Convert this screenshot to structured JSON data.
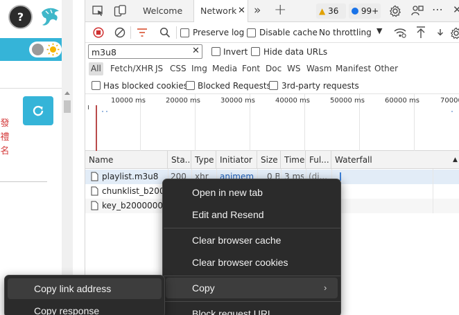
{
  "devtools": {
    "tabs": [
      {
        "label": "Welcome"
      },
      {
        "label": "Network"
      }
    ],
    "badges": {
      "warnings": "36",
      "issues": "99+"
    },
    "toolbar": {
      "preserve_log": "Preserve log",
      "disable_cache": "Disable cache",
      "throttling": "No throttling"
    },
    "filter": {
      "value": "m3u8",
      "invert": "Invert",
      "hide_data_urls": "Hide data URLs"
    },
    "types": [
      "All",
      "Fetch/XHR",
      "JS",
      "CSS",
      "Img",
      "Media",
      "Font",
      "Doc",
      "WS",
      "Wasm",
      "Manifest",
      "Other"
    ],
    "extra_filters": {
      "blocked_cookies": "Has blocked cookies",
      "blocked_requests": "Blocked Requests",
      "third_party": "3rd-party requests"
    },
    "timeline_ticks": [
      "10000 ms",
      "20000 ms",
      "30000 ms",
      "40000 ms",
      "50000 ms",
      "60000 ms",
      "70000"
    ],
    "columns": [
      "Name",
      "Sta...",
      "Type",
      "Initiator",
      "Size",
      "Time",
      "Ful...",
      "Waterfall"
    ],
    "rows": [
      {
        "name": "playlist.m3u8",
        "status": "200",
        "type": "xhr",
        "initiator": "animem...",
        "size": "0 B",
        "time": "3 ms",
        "full": "(di..."
      },
      {
        "name": "chunklist_b200...",
        "status": "",
        "type": "",
        "initiator": "",
        "size": "",
        "time": "",
        "full": ""
      },
      {
        "name": "key_b2000000...",
        "status": "",
        "type": "",
        "initiator": "",
        "size": "",
        "time": "",
        "full": ""
      }
    ]
  },
  "page": {
    "cjk_text": [
      "發",
      "禮",
      "名"
    ],
    "avatar_glyph": "?"
  },
  "context_menu": {
    "items": [
      "Open in new tab",
      "Edit and Resend",
      "Clear browser cache",
      "Clear browser cookies",
      "Copy",
      "Block request URL"
    ]
  },
  "copy_submenu": {
    "items": [
      "Copy link address",
      "Copy response"
    ]
  },
  "colors": {
    "accent_cyan": "#35b4d8",
    "record_red": "#d03131",
    "menu_bg": "#2b2b2b",
    "selected_row": "#e2ecf7"
  }
}
